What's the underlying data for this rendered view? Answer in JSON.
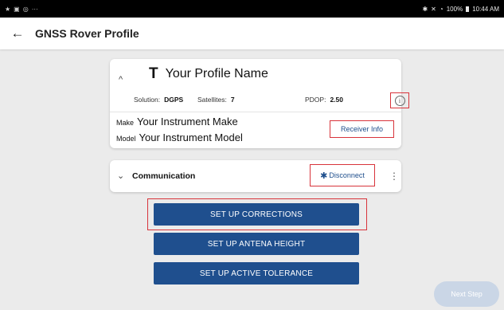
{
  "status_bar": {
    "left_icons": [
      "★",
      "▣",
      "◎",
      "···"
    ],
    "bluetooth": "✱",
    "mute": "✕",
    "wifi": "◔",
    "battery": "100%",
    "time": "10:44 AM"
  },
  "app_bar": {
    "back": "←",
    "title": "GNSS Rover Profile"
  },
  "profile_card": {
    "collapse_chevron": "^",
    "type_icon": "T",
    "profile_name": "Your Profile Name",
    "solution_label": "Solution:",
    "solution_value": "DGPS",
    "satellites_label": "Satellites:",
    "satellites_value": "7",
    "pdop_label": "PDOP:",
    "pdop_value": "2.50",
    "info_icon": "i",
    "make_label": "Make",
    "make_value": "Your Instrument Make",
    "model_label": "Model",
    "model_value": "Your Instrument Model",
    "receiver_info": "Receiver Info"
  },
  "comm_card": {
    "expand_chevron": "⌄",
    "title": "Communication",
    "disconnect_icon": "✱",
    "disconnect": "Disconnect",
    "more": "⋮"
  },
  "buttons": {
    "corrections": "SET UP CORRECTIONS",
    "antenna": "SET UP ANTENA HEIGHT",
    "tolerance": "SET UP ACTIVE TOLERANCE"
  },
  "fab_label": "Next Step",
  "colors": {
    "primary": "#1f4f8e",
    "highlight": "#d8343b"
  }
}
